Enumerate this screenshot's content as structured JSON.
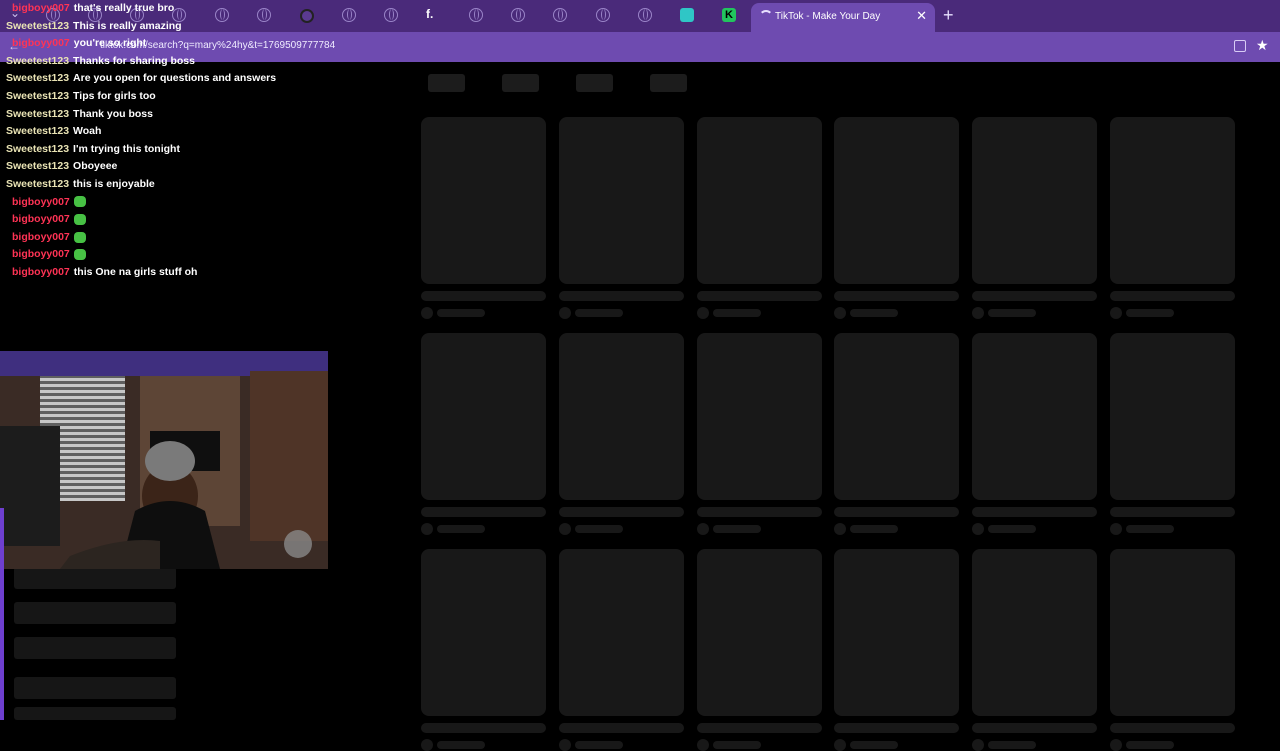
{
  "browser": {
    "active_tab_title": "TikTok - Make Your Day",
    "url": "tiktok.com/search?q=mary%24hy&t=1769509777784",
    "new_tab_icon": "+",
    "close_icon": "✕"
  },
  "chat": [
    {
      "user": "bigboyy007",
      "text": "that's really true bro",
      "color": "red"
    },
    {
      "user": "Sweetest123",
      "text": "This is really amazing",
      "color": "cream"
    },
    {
      "user": "bigboyy007",
      "text": "you're so right",
      "color": "red"
    },
    {
      "user": "Sweetest123",
      "text": "Thanks for sharing boss",
      "color": "cream"
    },
    {
      "user": "Sweetest123",
      "text": "Are you open for questions and answers",
      "color": "cream"
    },
    {
      "user": "Sweetest123",
      "text": "Tips for girls too",
      "color": "cream"
    },
    {
      "user": "Sweetest123",
      "text": "Thank you boss",
      "color": "cream"
    },
    {
      "user": "Sweetest123",
      "text": "Woah",
      "color": "cream"
    },
    {
      "user": "Sweetest123",
      "text": "I'm trying this tonight",
      "color": "cream"
    },
    {
      "user": "Sweetest123",
      "text": "Oboyeee",
      "color": "cream"
    },
    {
      "user": "Sweetest123",
      "text": "this is enjoyable",
      "color": "cream"
    },
    {
      "user": "bigboyy007",
      "text": "",
      "emoji": "emoji-icon",
      "color": "red"
    },
    {
      "user": "bigboyy007",
      "text": "",
      "emoji": "emoji-icon",
      "color": "red"
    },
    {
      "user": "bigboyy007",
      "text": "",
      "emoji": "emoji-icon",
      "color": "red"
    },
    {
      "user": "bigboyy007",
      "text": "",
      "emoji": "emoji-icon",
      "color": "red"
    },
    {
      "user": "bigboyy007",
      "text": "this One na girls stuff oh",
      "color": "red"
    }
  ],
  "colors": {
    "tabbar": "#4a2a7a",
    "addrbar": "#6e4bb0",
    "chat_user_cream": "#e9e3b4",
    "chat_user_red": "#ff3355",
    "placeholder": "#181818"
  }
}
